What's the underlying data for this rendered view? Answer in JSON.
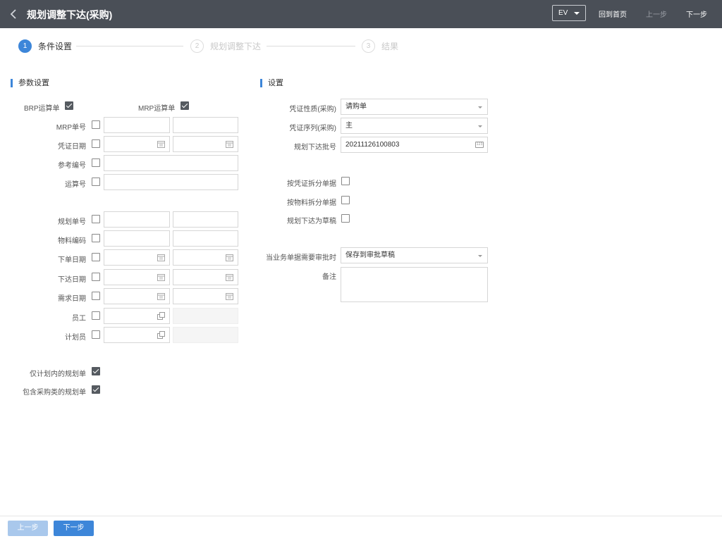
{
  "header": {
    "title": "规划调整下达(采购)",
    "ev_select": "EV",
    "home": "回到首页",
    "prev": "上一步",
    "next": "下一步"
  },
  "steps": [
    {
      "num": "1",
      "label": "条件设置"
    },
    {
      "num": "2",
      "label": "规划调整下达"
    },
    {
      "num": "3",
      "label": "结果"
    }
  ],
  "left": {
    "title": "参数设置",
    "brp_label": "BRP运算单",
    "mrp_label": "MRP运算单",
    "rows": {
      "mrp_no": "MRP单号",
      "voucher_date": "凭证日期",
      "ref_no": "参考编号",
      "calc_no": "运算号",
      "plan_no": "规划单号",
      "material_code": "物料编码",
      "order_date": "下单日期",
      "release_date": "下达日期",
      "demand_date": "需求日期",
      "employee": "员工",
      "planner": "计划员"
    },
    "only_in_plan": "仅计划内的规划单",
    "include_purchase": "包含采购类的规划单"
  },
  "right": {
    "title": "设置",
    "voucher_nature_label": "凭证性质(采购)",
    "voucher_nature_value": "请购单",
    "voucher_seq_label": "凭证序列(采购)",
    "voucher_seq_value": "主",
    "batch_no_label": "规划下达批号",
    "batch_no_value": "20211126100803",
    "split_by_voucher": "按凭证拆分单据",
    "split_by_material": "按物料拆分单据",
    "release_as_draft": "规划下达为草稿",
    "approval_label": "当业务单据需要审批时",
    "approval_value": "保存到审批草稿",
    "remark_label": "备注"
  },
  "footer": {
    "prev": "上一步",
    "next": "下一步"
  },
  "colors": {
    "header_bg": "#4a4f57",
    "accent": "#3d86d9",
    "checked": "#555a60"
  }
}
